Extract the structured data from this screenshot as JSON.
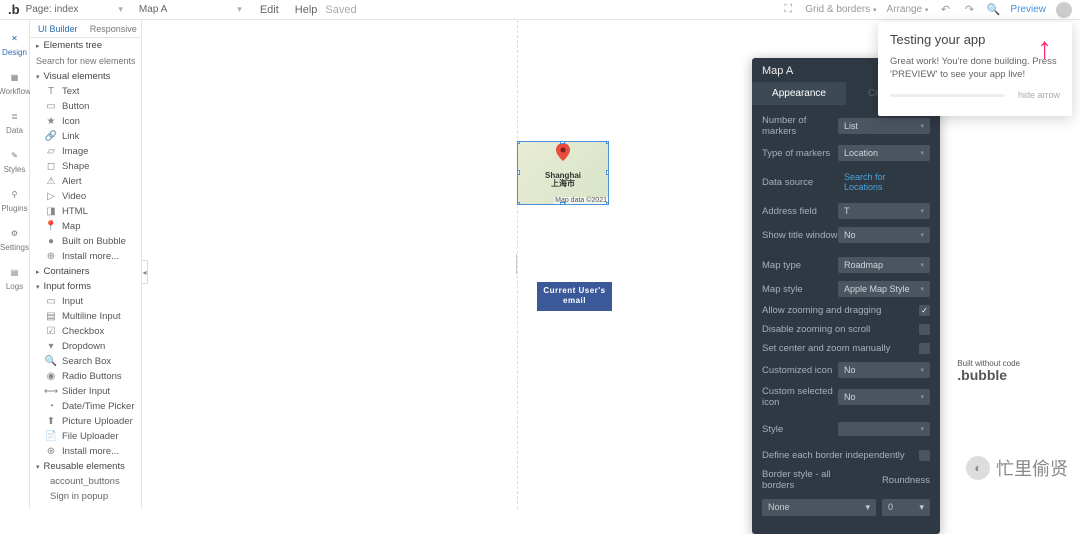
{
  "topbar": {
    "page_label": "Page:",
    "page_name": "index",
    "element_name": "Map A",
    "edit": "Edit",
    "help": "Help",
    "saved": "Saved",
    "grid": "Grid & borders",
    "arrange": "Arrange",
    "preview": "Preview"
  },
  "left_tabs": [
    "Design",
    "Workflow",
    "Data",
    "Styles",
    "Plugins",
    "Settings",
    "Logs"
  ],
  "panel": {
    "tabs": [
      "UI Builder",
      "Responsive"
    ],
    "sections": {
      "elements_tree": "Elements tree",
      "visual": "Visual elements",
      "containers": "Containers",
      "input_forms": "Input forms",
      "reusable": "Reusable elements"
    },
    "search_ph": "Search for new elements...",
    "visual_items": [
      "Text",
      "Button",
      "Icon",
      "Link",
      "Image",
      "Shape",
      "Alert",
      "Video",
      "HTML",
      "Map",
      "Built on Bubble",
      "Install more..."
    ],
    "input_items": [
      "Input",
      "Multiline Input",
      "Checkbox",
      "Dropdown",
      "Search Box",
      "Radio Buttons",
      "Slider Input",
      "Date/Time Picker",
      "Picture Uploader",
      "File Uploader",
      "Install more..."
    ],
    "reusable_items": [
      "account_buttons",
      "Sign in popup"
    ]
  },
  "canvas": {
    "map_city": "Shanghai",
    "map_city_cn": "上海市",
    "map_attr": "Map data ©2021",
    "email_text": "Current User's email"
  },
  "prop": {
    "title": "Map A",
    "tabs": [
      "Appearance",
      "Conditional"
    ],
    "rows": {
      "num_markers": {
        "label": "Number of markers",
        "val": "List"
      },
      "type_markers": {
        "label": "Type of markers",
        "val": "Location"
      },
      "data_source": {
        "label": "Data source",
        "val": "Search for Locations"
      },
      "addr_field": {
        "label": "Address field",
        "val": "T"
      },
      "show_title": {
        "label": "Show title window",
        "val": "No"
      },
      "map_type": {
        "label": "Map type",
        "val": "Roadmap"
      },
      "map_style": {
        "label": "Map style",
        "val": "Apple Map Style"
      },
      "allow_zoom": {
        "label": "Allow zooming and dragging",
        "checked": true
      },
      "disable_scroll": {
        "label": "Disable zooming on scroll",
        "checked": false
      },
      "set_center": {
        "label": "Set center and zoom manually",
        "checked": false
      },
      "custom_icon": {
        "label": "Customized icon",
        "val": "No"
      },
      "custom_sel_icon": {
        "label": "Custom selected icon",
        "val": "No"
      },
      "style": {
        "label": "Style",
        "val": ""
      },
      "define_border": {
        "label": "Define each border independently",
        "checked": false
      },
      "border_style_label": "Border style - all borders",
      "roundness_label": "Roundness",
      "border_style": "None",
      "roundness": "0"
    }
  },
  "tip": {
    "title": "Testing your app",
    "body": "Great work! You're done building. Press 'PREVIEW' to see your app live!",
    "hide": "hide arrow"
  },
  "watermark": {
    "small": "Built without code",
    "brand": ".bubble"
  },
  "cn": "忙里偷贤"
}
